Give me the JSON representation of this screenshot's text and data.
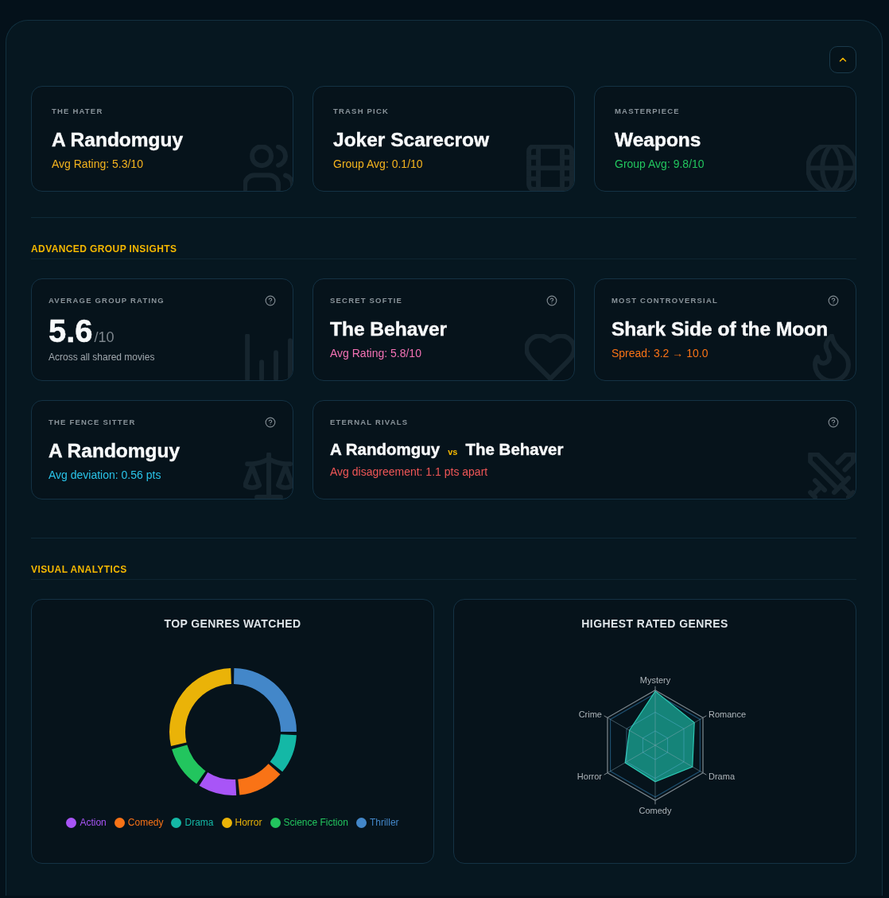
{
  "collapse_button": {
    "expanded": true
  },
  "highlights": [
    {
      "label": "THE HATER",
      "title": "A Randomguy",
      "detail": "Avg Rating: 5.3/10",
      "color": "#f5b41e"
    },
    {
      "label": "TRASH PICK",
      "title": "Joker Scarecrow",
      "detail": "Group Avg: 0.1/10",
      "color": "#f5b41e"
    },
    {
      "label": "MASTERPIECE",
      "title": "Weapons",
      "detail": "Group Avg: 9.8/10",
      "color": "#22c55e"
    }
  ],
  "insights": {
    "heading": "ADVANCED GROUP INSIGHTS",
    "cards": [
      {
        "kind": "stat",
        "label": "AVERAGE GROUP RATING",
        "value": "5.6",
        "unit": "/10",
        "caption": "Across all shared movies"
      },
      {
        "kind": "pick",
        "label": "SECRET SOFTIE",
        "title": "The Behaver",
        "detail": "Avg Rating: 5.8/10",
        "color": "#f472b6"
      },
      {
        "kind": "pick",
        "label": "MOST CONTROVERSIAL",
        "title": "Shark Side of the Moon",
        "detail": "Spread: 3.2 → 10.0",
        "color": "#f97316"
      },
      {
        "kind": "pick",
        "label": "THE FENCE SITTER",
        "title": "A Randomguy",
        "detail": "Avg deviation: 0.56 pts",
        "color": "#2ac3e8"
      },
      {
        "kind": "rivals",
        "label": "ETERNAL RIVALS",
        "left": "A Randomguy",
        "joiner": "vs",
        "right": "The Behaver",
        "detail": "Avg disagreement: 1.1 pts apart",
        "color": "#f05656"
      }
    ]
  },
  "analytics": {
    "heading": "VISUAL ANALYTICS",
    "charts": [
      {
        "kind": "donut",
        "title": "TOP GENRES WATCHED",
        "legend": [
          {
            "label": "Action",
            "color": "#a855f7"
          },
          {
            "label": "Comedy",
            "color": "#f97316"
          },
          {
            "label": "Drama",
            "color": "#14b8a6"
          },
          {
            "label": "Horror",
            "color": "#eab308"
          },
          {
            "label": "Science Fiction",
            "color": "#22c55e"
          },
          {
            "label": "Thriller",
            "color": "#4387c9"
          }
        ]
      },
      {
        "kind": "radar",
        "title": "HIGHEST RATED GENRES",
        "axes": [
          "Mystery",
          "Romance",
          "Drama",
          "Comedy",
          "Horror",
          "Crime"
        ]
      }
    ]
  }
}
